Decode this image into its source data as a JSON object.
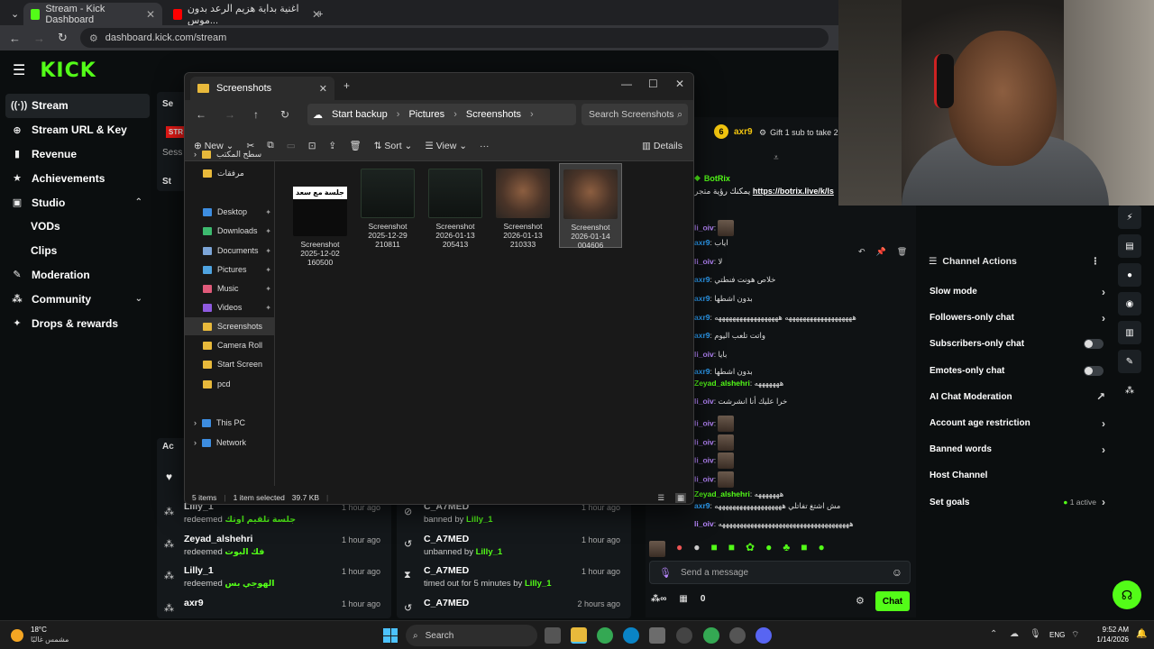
{
  "browser": {
    "tabs": [
      {
        "title": "Stream - Kick Dashboard",
        "active": true
      },
      {
        "title": "اغنية بداية هزيم الرعد بدون موس...",
        "active": false
      }
    ],
    "url": "dashboard.kick.com/stream"
  },
  "kick": {
    "logo": "KICK",
    "beta": "BETA",
    "sidebar": [
      {
        "label": "Stream",
        "icon": "wave-icon",
        "active": true
      },
      {
        "label": "Stream URL & Key",
        "icon": "globe-icon"
      },
      {
        "label": "Revenue",
        "icon": "chart-icon"
      },
      {
        "label": "Achievements",
        "icon": "trophy-icon"
      },
      {
        "label": "Studio",
        "icon": "studio-icon",
        "chevron": "^"
      },
      {
        "label": "VODs",
        "sub": true
      },
      {
        "label": "Clips",
        "sub": true
      },
      {
        "label": "Moderation",
        "icon": "wrench-icon"
      },
      {
        "label": "Community",
        "icon": "people-icon",
        "chevron": "v"
      },
      {
        "label": "Drops & rewards",
        "icon": "drops-icon"
      }
    ],
    "peek_labels": {
      "se": "Se",
      "str": "STR",
      "sess": "Sess",
      "st": "St",
      "ac": "Ac"
    },
    "activity_feed": [
      {
        "user": "Lilly_1",
        "action": "redeemed",
        "reward": "جلسة تلقيم اوتك",
        "time": "1 hour ago"
      },
      {
        "user": "Zeyad_alshehri",
        "action": "redeemed",
        "reward": "فك البوت",
        "time": "1 hour ago"
      },
      {
        "user": "Lilly_1",
        "action": "redeemed",
        "reward": "الهوجي بس",
        "time": "1 hour ago"
      },
      {
        "user": "axr9",
        "action": "",
        "reward": "",
        "time": "1 hour ago"
      }
    ],
    "mod_feed": [
      {
        "user": "C_A7MED",
        "action": "banned by",
        "by": "Lilly_1",
        "time": "1 hour ago",
        "icon": "ban-icon"
      },
      {
        "user": "C_A7MED",
        "action": "unbanned by",
        "by": "Lilly_1",
        "time": "1 hour ago",
        "icon": "undo-icon"
      },
      {
        "user": "C_A7MED",
        "action": "timed out for 5 minutes by",
        "by": "Lilly_1",
        "time": "1 hour ago",
        "icon": "hourglass-icon"
      },
      {
        "user": "C_A7MED",
        "action": "",
        "by": "",
        "time": "2 hours ago",
        "icon": "undo-icon"
      }
    ],
    "chat": {
      "pinned_user": "axr9",
      "pinned_count": "6",
      "gift_text": "Gift 1 sub to take 2n",
      "bot_name": "BotRix",
      "bot_link": "https://botrix.live/k/ls",
      "bot_prefix": "يمكنك رؤية متجر",
      "messages": [
        {
          "user": "li_oiv",
          "text": ""
        },
        {
          "user": "axr9",
          "text": "اياب"
        },
        {
          "user": "li_oiv",
          "text": "لا"
        },
        {
          "user": "axr9",
          "text": "خلاص هونت فنطتي"
        },
        {
          "user": "axr9",
          "text": "بدون اشطها"
        },
        {
          "user": "axr9",
          "text": "هههههههههههههههههههه ههههههههههههههههههه"
        },
        {
          "user": "axr9",
          "text": "واتت تلعب اليوم"
        },
        {
          "user": "li_oiv",
          "text": "بايا"
        },
        {
          "user": "axr9",
          "text": "بدون اشطها"
        },
        {
          "user": "Zeyad_alshehri",
          "text": "هههههههه"
        },
        {
          "user": "li_oiv",
          "text": "خرا عليك أنا انشرشت"
        },
        {
          "user": "li_oiv",
          "text": ""
        },
        {
          "user": "li_oiv",
          "text": ""
        },
        {
          "user": "li_oiv",
          "text": ""
        },
        {
          "user": "li_oiv",
          "text": ""
        },
        {
          "user": "Zeyad_alshehri",
          "text": "هههههههه"
        },
        {
          "user": "axr9",
          "text": "مش اشتغ تفاتلي هههههههههههههههههههه"
        },
        {
          "user": "li_oiv",
          "text": "هههههههههههههههههههههههههههههههههههههه"
        }
      ],
      "input_placeholder": "Send a message",
      "viewer_count": "0",
      "chat_button": "Chat"
    },
    "channel_actions": {
      "title": "Channel Actions",
      "items": [
        {
          "label": "Slow mode",
          "control": "chevron"
        },
        {
          "label": "Followers-only chat",
          "control": "chevron"
        },
        {
          "label": "Subscribers-only chat",
          "control": "toggle"
        },
        {
          "label": "Emotes-only chat",
          "control": "toggle"
        },
        {
          "label": "AI Chat Moderation",
          "control": "external"
        },
        {
          "label": "Account age restriction",
          "control": "chevron"
        },
        {
          "label": "Banned words",
          "control": "chevron"
        },
        {
          "label": "Host Channel",
          "control": "none"
        },
        {
          "label": "Set goals",
          "control": "chevron",
          "badge": "1 active"
        }
      ]
    }
  },
  "explorer": {
    "tab_title": "Screenshots",
    "breadcrumb": [
      "Start backup",
      "Pictures",
      "Screenshots"
    ],
    "search_placeholder": "Search Screenshots",
    "toolbar": {
      "new": "New",
      "sort": "Sort",
      "view": "View",
      "details": "Details"
    },
    "nav": [
      {
        "label": "سطح المكتب",
        "kind": "folder",
        "expander": true
      },
      {
        "label": "مرفقات",
        "kind": "folder"
      },
      {
        "label": "Desktop",
        "kind": "desktop",
        "pinned": true
      },
      {
        "label": "Downloads",
        "kind": "downloads",
        "pinned": true
      },
      {
        "label": "Documents",
        "kind": "documents",
        "pinned": true
      },
      {
        "label": "Pictures",
        "kind": "pictures",
        "pinned": true
      },
      {
        "label": "Music",
        "kind": "music",
        "pinned": true
      },
      {
        "label": "Videos",
        "kind": "videos",
        "pinned": true
      },
      {
        "label": "Screenshots",
        "kind": "folder",
        "selected": true
      },
      {
        "label": "Camera Roll",
        "kind": "folder"
      },
      {
        "label": "Start Screen",
        "kind": "folder"
      },
      {
        "label": "pcd",
        "kind": "folder"
      },
      {
        "label": "This PC",
        "kind": "pc",
        "expander": true
      },
      {
        "label": "Network",
        "kind": "network",
        "expander": true
      }
    ],
    "files": [
      {
        "name": "Screenshot",
        "date": "2025-12-02",
        "time": "160500",
        "thumb_text": "جلسة مع سعد",
        "thumb": "white"
      },
      {
        "name": "Screenshot",
        "date": "2025-12-29",
        "time": "210811",
        "thumb": "dark"
      },
      {
        "name": "Screenshot",
        "date": "2026-01-13",
        "time": "205413",
        "thumb": "dark"
      },
      {
        "name": "Screenshot",
        "date": "2026-01-13",
        "time": "210333",
        "thumb": "face"
      },
      {
        "name": "Screenshot",
        "date": "2026-01-14",
        "time": "004606",
        "thumb": "face",
        "selected": true
      }
    ],
    "status": {
      "items": "5 items",
      "selected": "1 item selected",
      "size": "39.7 KB"
    }
  },
  "taskbar": {
    "weather_temp": "18°C",
    "weather_desc": "مشمس غالبًا",
    "search": "Search",
    "lang": "ENG",
    "time": "9:52 AM",
    "date": "1/14/2026"
  },
  "colors": {
    "kick_green": "#53fc18",
    "folder_yellow": "#e8b93b",
    "link_blue": "#2fa5ff"
  }
}
